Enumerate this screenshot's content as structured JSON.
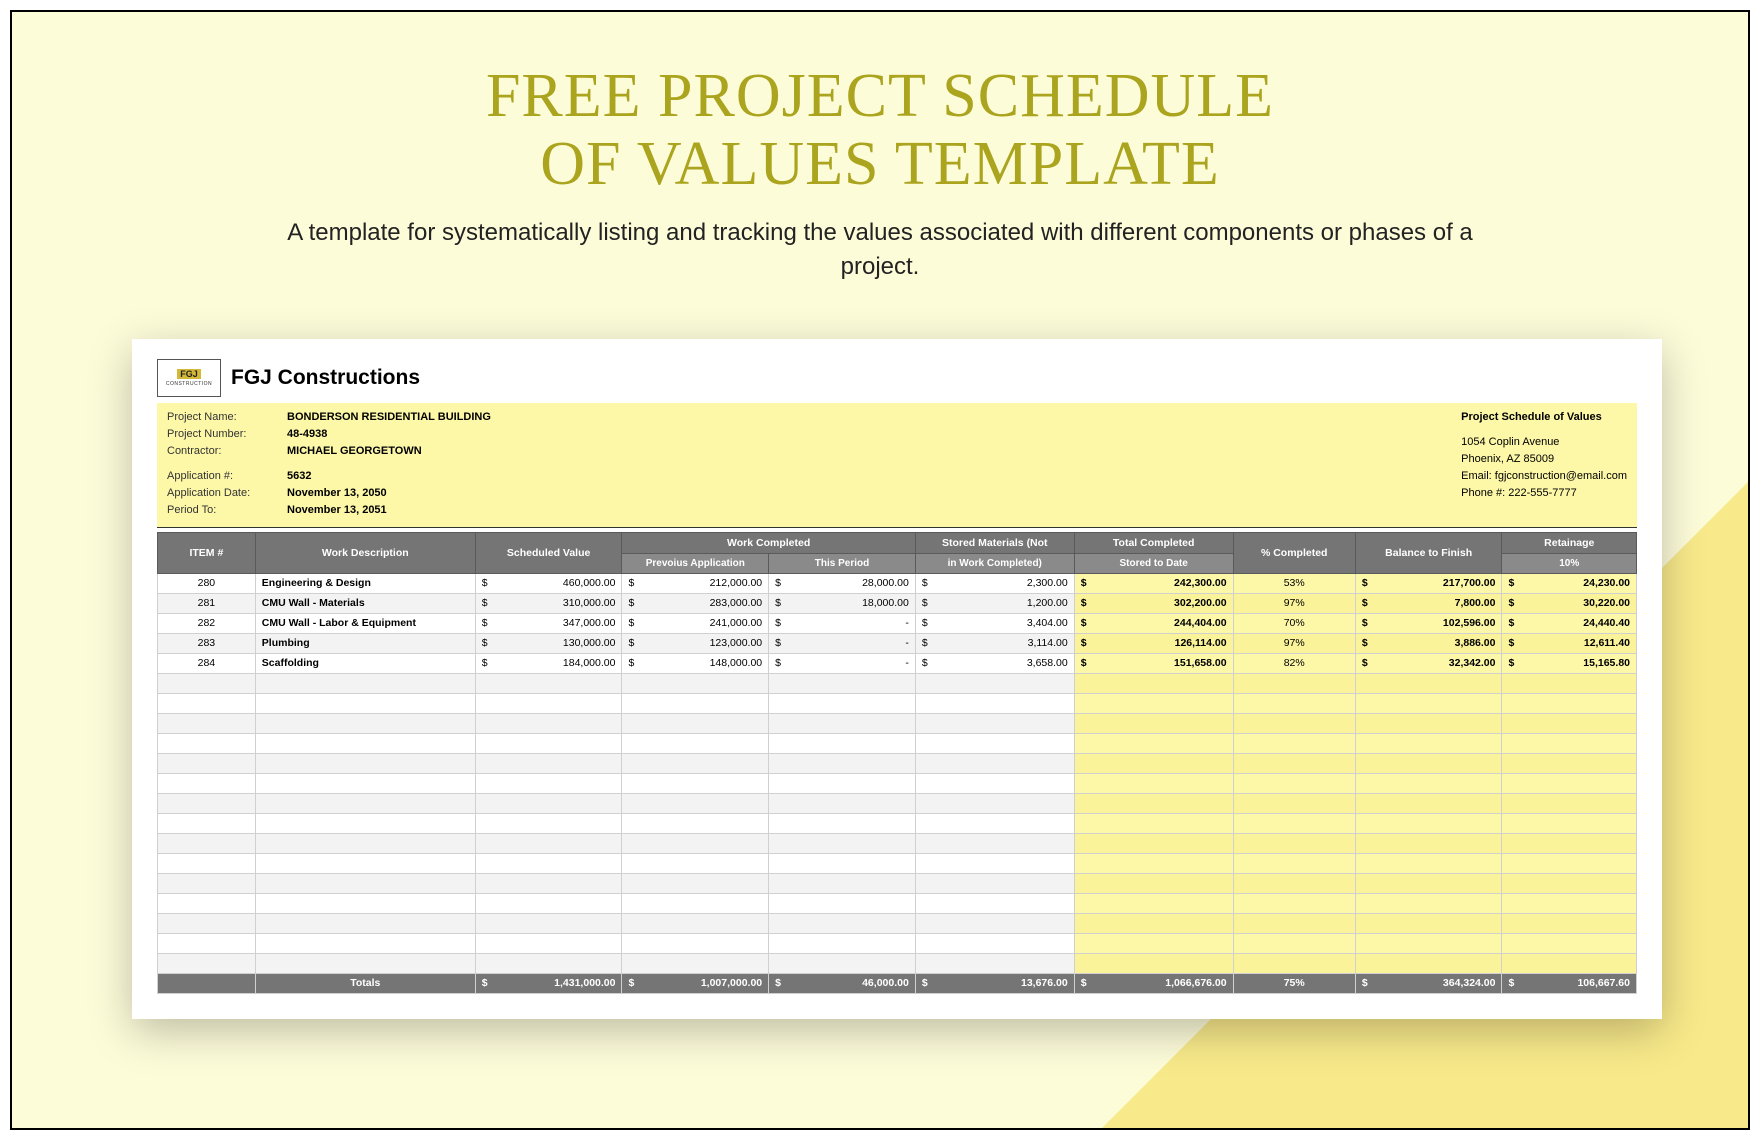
{
  "page": {
    "title_line1": "FREE PROJECT SCHEDULE",
    "title_line2": "OF VALUES TEMPLATE",
    "subtitle": "A template for systematically listing and tracking the values associated with different components or phases of a project."
  },
  "company": {
    "logo_text": "FGJ",
    "logo_sub": "CONSTRUCTION",
    "name": "FGJ Constructions"
  },
  "info": {
    "project_name_lbl": "Project Name:",
    "project_name": "BONDERSON RESIDENTIAL BUILDING",
    "project_number_lbl": "Project Number:",
    "project_number": "48-4938",
    "contractor_lbl": "Contractor:",
    "contractor": "MICHAEL GEORGETOWN",
    "app_num_lbl": "Application #:",
    "app_num": "5632",
    "app_date_lbl": "Application Date:",
    "app_date": "November 13, 2050",
    "period_to_lbl": "Period To:",
    "period_to": "November 13, 2051",
    "right_heading": "Project Schedule of Values",
    "addr1": "1054 Coplin Avenue",
    "addr2": "Phoenix, AZ 85009",
    "email": "Email: fgjconstruction@email.com",
    "phone": "Phone #: 222-555-7777"
  },
  "headers": {
    "item": "ITEM #",
    "desc": "Work Description",
    "sched": "Scheduled Value",
    "work_comp": "Work Completed",
    "prev": "Prevoius Application",
    "this_period": "This Period",
    "stored_top": "Stored Materials (Not",
    "stored_bot": "in Work Completed)",
    "total_top": "Total Completed",
    "total_bot": "Stored to Date",
    "pct": "% Completed",
    "balance": "Balance to Finish",
    "ret_top": "Retainage",
    "ret_bot": "10%"
  },
  "rows": [
    {
      "item": "280",
      "desc": "Engineering & Design",
      "sched": "460,000.00",
      "prev": "212,000.00",
      "this": "28,000.00",
      "stored": "2,300.00",
      "total": "242,300.00",
      "pct": "53%",
      "bal": "217,700.00",
      "ret": "24,230.00"
    },
    {
      "item": "281",
      "desc": "CMU Wall - Materials",
      "sched": "310,000.00",
      "prev": "283,000.00",
      "this": "18,000.00",
      "stored": "1,200.00",
      "total": "302,200.00",
      "pct": "97%",
      "bal": "7,800.00",
      "ret": "30,220.00"
    },
    {
      "item": "282",
      "desc": "CMU Wall - Labor & Equipment",
      "sched": "347,000.00",
      "prev": "241,000.00",
      "this": "-",
      "stored": "3,404.00",
      "total": "244,404.00",
      "pct": "70%",
      "bal": "102,596.00",
      "ret": "24,440.40"
    },
    {
      "item": "283",
      "desc": "Plumbing",
      "sched": "130,000.00",
      "prev": "123,000.00",
      "this": "-",
      "stored": "3,114.00",
      "total": "126,114.00",
      "pct": "97%",
      "bal": "3,886.00",
      "ret": "12,611.40"
    },
    {
      "item": "284",
      "desc": "Scaffolding",
      "sched": "184,000.00",
      "prev": "148,000.00",
      "this": "-",
      "stored": "3,658.00",
      "total": "151,658.00",
      "pct": "82%",
      "bal": "32,342.00",
      "ret": "15,165.80"
    }
  ],
  "totals": {
    "label": "Totals",
    "sched": "1,431,000.00",
    "prev": "1,007,000.00",
    "this": "46,000.00",
    "stored": "13,676.00",
    "total": "1,066,676.00",
    "pct": "75%",
    "bal": "364,324.00",
    "ret": "106,667.60"
  },
  "chart_data": {
    "type": "table",
    "title": "Project Schedule of Values",
    "columns": [
      "ITEM #",
      "Work Description",
      "Scheduled Value",
      "Work Completed — Previous Application",
      "Work Completed — This Period",
      "Stored Materials (Not in Work Completed)",
      "Total Completed Stored to Date",
      "% Completed",
      "Balance to Finish",
      "Retainage 10%"
    ],
    "rows": [
      [
        280,
        "Engineering & Design",
        460000.0,
        212000.0,
        28000.0,
        2300.0,
        242300.0,
        53,
        217700.0,
        24230.0
      ],
      [
        281,
        "CMU Wall - Materials",
        310000.0,
        283000.0,
        18000.0,
        1200.0,
        302200.0,
        97,
        7800.0,
        30220.0
      ],
      [
        282,
        "CMU Wall - Labor & Equipment",
        347000.0,
        241000.0,
        null,
        3404.0,
        244404.0,
        70,
        102596.0,
        24440.4
      ],
      [
        283,
        "Plumbing",
        130000.0,
        123000.0,
        null,
        3114.0,
        126114.0,
        97,
        3886.0,
        12611.4
      ],
      [
        284,
        "Scaffolding",
        184000.0,
        148000.0,
        null,
        3658.0,
        151658.0,
        82,
        32342.0,
        15165.8
      ]
    ],
    "totals": [
      null,
      "Totals",
      1431000.0,
      1007000.0,
      46000.0,
      13676.0,
      1066676.0,
      75,
      364324.0,
      106667.6
    ]
  }
}
